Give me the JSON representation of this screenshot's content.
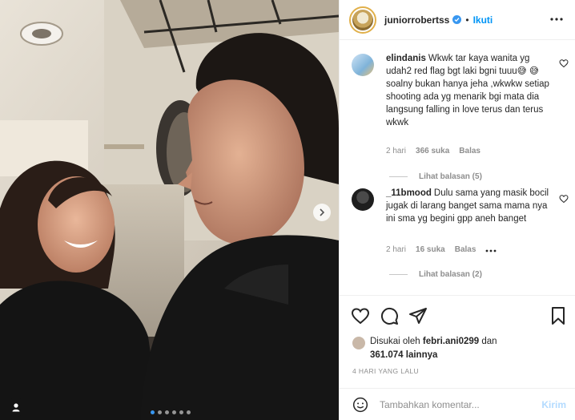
{
  "post": {
    "username": "juniorrobertss",
    "follow_label": "Ikuti",
    "separator": "•"
  },
  "comments": [
    {
      "username": "elindanis",
      "text": "Wkwk tar kaya wanita yg udah2 red flag bgt laki bgni tuuu😅 😅 soalny bukan hanya jeha ,wkwkw setiap shooting ada yg menarik bgi mata dia langsung falling in love terus dan terus wkwk",
      "time": "2 hari",
      "likes": "366 suka",
      "reply_label": "Balas",
      "view_replies": "Lihat balasan (5)"
    },
    {
      "username": "_11bmood",
      "text": "Dulu sama yang masik bocil jugak di larang banget sama mama nya ini sma yg begini gpp aneh banget",
      "time": "2 hari",
      "likes": "16 suka",
      "reply_label": "Balas",
      "view_replies": "Lihat balasan (2)"
    }
  ],
  "likes_section": {
    "prefix": "Disukai oleh",
    "liker": "febri.ani0299",
    "connector": "dan",
    "others": "361.074 lainnya"
  },
  "date": "4 HARI YANG LALU",
  "composer": {
    "placeholder": "Tambahkan komentar...",
    "send_label": "Kirim"
  },
  "carousel": {
    "total": 6,
    "active_index": 0
  },
  "icons": {
    "verified": "verified-badge-icon",
    "more": "more-options-icon",
    "like": "heart-icon",
    "comment": "comment-bubble-icon",
    "share": "paper-plane-icon",
    "save": "bookmark-icon",
    "emoji": "emoji-icon",
    "next": "chevron-right-icon",
    "tag": "user-tag-icon"
  },
  "colors": {
    "accent": "#0095f6",
    "verified": "#3897f0",
    "muted": "#8e8e8e",
    "send_disabled": "#b3dbff"
  }
}
